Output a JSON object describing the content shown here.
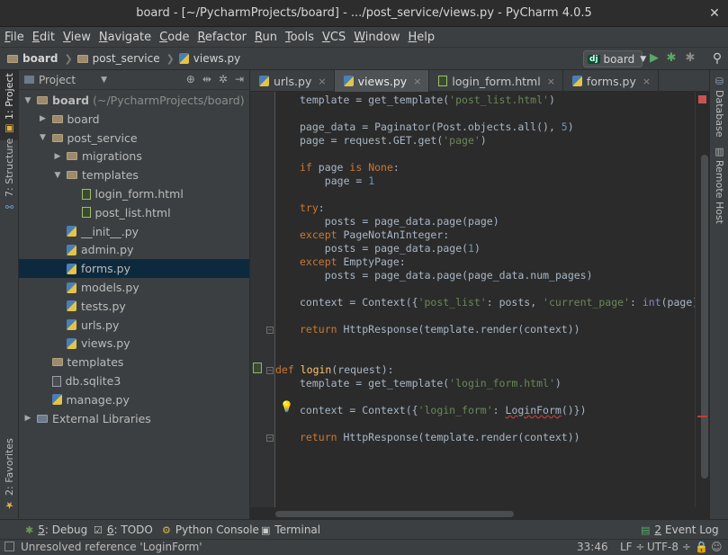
{
  "window": {
    "title": "board - [~/PycharmProjects/board] - .../post_service/views.py - PyCharm 4.0.5",
    "close_glyph": "✕"
  },
  "menu": [
    {
      "u": "F",
      "rest": "ile"
    },
    {
      "u": "E",
      "rest": "dit"
    },
    {
      "u": "V",
      "rest": "iew"
    },
    {
      "u": "N",
      "rest": "avigate"
    },
    {
      "u": "C",
      "rest": "ode"
    },
    {
      "u": "R",
      "rest": "efactor"
    },
    {
      "u": "R",
      "rest": "un"
    },
    {
      "u": "T",
      "rest": "ools"
    },
    {
      "u": "V",
      "rest": "CS"
    },
    {
      "u": "W",
      "rest": "indow"
    },
    {
      "u": "H",
      "rest": "elp"
    }
  ],
  "navbar": {
    "crumbs": [
      "board",
      "post_service",
      "views.py"
    ],
    "run_config": {
      "badge": "dj",
      "label": "board",
      "arrow": "▼"
    },
    "icons": {
      "run": "▶",
      "debug": "✱",
      "coverage": "✱",
      "search": "⚲"
    }
  },
  "left_strip": {
    "project_tab": "1: Project",
    "structure_tab": "7: Structure",
    "favorites_tab": "2: Favorites"
  },
  "right_strip": {
    "database_tab": "Database",
    "remote_host_tab": "Remote Host"
  },
  "project_panel": {
    "header_label": "Project",
    "header_arrow": "▼",
    "header_icons": [
      "⊕",
      "⇹",
      "✲",
      "⇥"
    ],
    "tree": [
      {
        "name": "board",
        "hint": "(~/PycharmProjects/board)",
        "type": "folder",
        "arrow": "▼",
        "depth": 0,
        "bold": true
      },
      {
        "name": "board",
        "type": "folder",
        "arrow": "▶",
        "depth": 1
      },
      {
        "name": "post_service",
        "type": "folder",
        "arrow": "▼",
        "depth": 1
      },
      {
        "name": "migrations",
        "type": "folder",
        "arrow": "▶",
        "depth": 2
      },
      {
        "name": "templates",
        "type": "folder",
        "arrow": "▼",
        "depth": 2
      },
      {
        "name": "login_form.html",
        "type": "html",
        "arrow": "",
        "depth": 3
      },
      {
        "name": "post_list.html",
        "type": "html",
        "arrow": "",
        "depth": 3
      },
      {
        "name": "__init__.py",
        "type": "py",
        "arrow": "",
        "depth": 2
      },
      {
        "name": "admin.py",
        "type": "py",
        "arrow": "",
        "depth": 2
      },
      {
        "name": "forms.py",
        "type": "py",
        "arrow": "",
        "depth": 2,
        "selected": true
      },
      {
        "name": "models.py",
        "type": "py",
        "arrow": "",
        "depth": 2
      },
      {
        "name": "tests.py",
        "type": "py",
        "arrow": "",
        "depth": 2
      },
      {
        "name": "urls.py",
        "type": "py",
        "arrow": "",
        "depth": 2
      },
      {
        "name": "views.py",
        "type": "py",
        "arrow": "",
        "depth": 2
      },
      {
        "name": "templates",
        "type": "folder",
        "arrow": "",
        "depth": 1
      },
      {
        "name": "db.sqlite3",
        "type": "db",
        "arrow": "",
        "depth": 1
      },
      {
        "name": "manage.py",
        "type": "py",
        "arrow": "",
        "depth": 1
      },
      {
        "name": "External Libraries",
        "type": "lib",
        "arrow": "▶",
        "depth": 0
      }
    ]
  },
  "editor_tabs": [
    {
      "label": "urls.py",
      "type": "py",
      "active": false
    },
    {
      "label": "views.py",
      "type": "py",
      "active": true
    },
    {
      "label": "login_form.html",
      "type": "html",
      "active": false
    },
    {
      "label": "forms.py",
      "type": "py",
      "active": false
    }
  ],
  "tab_close_glyph": "×",
  "code_lines": [
    {
      "line": 0,
      "indent": 4,
      "html": "template = get_template(<span class=\"str\">'post_list.html'</span>)"
    },
    {
      "line": 2,
      "indent": 4,
      "html": "page_data = Paginator(Post.objects.all(), <span class=\"num\">5</span>)"
    },
    {
      "line": 3,
      "indent": 4,
      "html": "page = request.GET.get(<span class=\"str\">'page'</span>)"
    },
    {
      "line": 5,
      "indent": 4,
      "html": "<span class=\"kw\">if</span> page <span class=\"kw\">is</span> <span class=\"kw\">None</span>:"
    },
    {
      "line": 6,
      "indent": 8,
      "html": "page = <span class=\"num\">1</span>"
    },
    {
      "line": 8,
      "indent": 4,
      "html": "<span class=\"kw\">try</span>:"
    },
    {
      "line": 9,
      "indent": 8,
      "html": "posts = page_data.page(page)"
    },
    {
      "line": 10,
      "indent": 4,
      "html": "<span class=\"kw\">except</span> PageNotAnInteger:"
    },
    {
      "line": 11,
      "indent": 8,
      "html": "posts = page_data.page(<span class=\"num\">1</span>)"
    },
    {
      "line": 12,
      "indent": 4,
      "html": "<span class=\"kw\">except</span> EmptyPage:"
    },
    {
      "line": 13,
      "indent": 8,
      "html": "posts = page_data.page(page_data.num_pages)"
    },
    {
      "line": 15,
      "indent": 4,
      "html": "context = Context({<span class=\"str\">'post_list'</span>: posts, <span class=\"str\">'current_page'</span>: <span class=\"builtin\">int</span>(page),"
    },
    {
      "line": 17,
      "indent": 4,
      "html": "<span class=\"kw\">return</span> HttpResponse(template.render(context))"
    },
    {
      "line": 20,
      "indent": 0,
      "html": "<span class=\"kw\">def</span> <span class=\"fn\">login</span>(request):"
    },
    {
      "line": 21,
      "indent": 4,
      "html": "template = get_template(<span class=\"str\">'login_form.html'</span>)"
    },
    {
      "line": 23,
      "indent": 4,
      "html": "context = Context({<span class=\"str\">'login_form'</span>: <span class=\"err\">LoginForm</span>()})"
    },
    {
      "line": 25,
      "indent": 4,
      "html": "<span class=\"kw\">return</span> HttpResponse(template.render(context))"
    }
  ],
  "bottom_tools": [
    {
      "icon": "✱",
      "key": "5",
      "label": ": Debug",
      "color": "#6a9955"
    },
    {
      "icon": "☑",
      "key": "6",
      "label": ": TODO",
      "color": "#c8c8c8"
    },
    {
      "icon": "⚙",
      "key": "",
      "label": "Python Console",
      "color": "#d5b64a"
    },
    {
      "icon": "▣",
      "key": "",
      "label": "Terminal",
      "color": "#c8c8c8"
    }
  ],
  "event_log": {
    "count": "2",
    "label": "Event Log"
  },
  "status": {
    "message": "Unresolved reference 'LoginForm'",
    "position": "33:46",
    "line_sep": "LF",
    "encoding": "UTF-8",
    "sep_arrow": "÷"
  }
}
